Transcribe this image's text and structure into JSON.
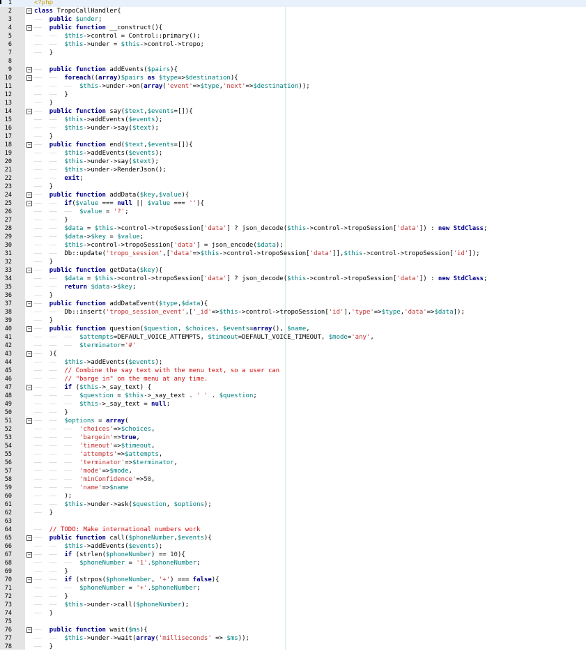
{
  "editor": {
    "lines": [
      {
        "n": "1",
        "fold": "",
        "code": "<?php"
      },
      {
        "n": "2",
        "fold": "−",
        "code": "class TropoCallHandler{"
      },
      {
        "n": "3",
        "fold": "",
        "code": "    public $under;"
      },
      {
        "n": "4",
        "fold": "−",
        "code": "    public function __construct(){"
      },
      {
        "n": "5",
        "fold": "",
        "code": "        $this->control = Control::primary();"
      },
      {
        "n": "6",
        "fold": "",
        "code": "        $this->under = $this->control->tropo;"
      },
      {
        "n": "7",
        "fold": "",
        "code": "    }"
      },
      {
        "n": "8",
        "fold": "",
        "code": ""
      },
      {
        "n": "9",
        "fold": "−",
        "code": "    public function addEvents($pairs){"
      },
      {
        "n": "10",
        "fold": "−",
        "code": "        foreach((array)$pairs as $type=>$destination){"
      },
      {
        "n": "11",
        "fold": "",
        "code": "            $this->under->on(array('event'=>$type,'next'=>$destination));"
      },
      {
        "n": "12",
        "fold": "",
        "code": "        }"
      },
      {
        "n": "13",
        "fold": "",
        "code": "    }"
      },
      {
        "n": "14",
        "fold": "−",
        "code": "    public function say($text,$events=[]){"
      },
      {
        "n": "15",
        "fold": "",
        "code": "        $this->addEvents($events);"
      },
      {
        "n": "16",
        "fold": "",
        "code": "        $this->under->say($text);"
      },
      {
        "n": "17",
        "fold": "",
        "code": "    }"
      },
      {
        "n": "18",
        "fold": "−",
        "code": "    public function end($text,$events=[]){"
      },
      {
        "n": "19",
        "fold": "",
        "code": "        $this->addEvents($events);"
      },
      {
        "n": "20",
        "fold": "",
        "code": "        $this->under->say($text);"
      },
      {
        "n": "21",
        "fold": "",
        "code": "        $this->under->RenderJson();"
      },
      {
        "n": "22",
        "fold": "",
        "code": "        exit;"
      },
      {
        "n": "23",
        "fold": "",
        "code": "    }"
      },
      {
        "n": "24",
        "fold": "−",
        "code": "    public function addData($key,$value){"
      },
      {
        "n": "25",
        "fold": "−",
        "code": "        if($value === null || $value === ''){"
      },
      {
        "n": "26",
        "fold": "",
        "code": "            $value = '?';"
      },
      {
        "n": "27",
        "fold": "",
        "code": "        }"
      },
      {
        "n": "28",
        "fold": "",
        "code": "        $data = $this->control->tropoSession['data'] ? json_decode($this->control->tropoSession['data']) : new StdClass;"
      },
      {
        "n": "29",
        "fold": "",
        "code": "        $data->$key = $value;"
      },
      {
        "n": "30",
        "fold": "",
        "code": "        $this->control->tropoSession['data'] = json_encode($data);"
      },
      {
        "n": "31",
        "fold": "",
        "code": "        Db::update('tropo_session',['data'=>$this->control->tropoSession['data']],$this->control->tropoSession['id']);"
      },
      {
        "n": "32",
        "fold": "",
        "code": "    }"
      },
      {
        "n": "33",
        "fold": "−",
        "code": "    public function getData($key){"
      },
      {
        "n": "34",
        "fold": "",
        "code": "        $data = $this->control->tropoSession['data'] ? json_decode($this->control->tropoSession['data']) : new StdClass;"
      },
      {
        "n": "35",
        "fold": "",
        "code": "        return $data->$key;"
      },
      {
        "n": "36",
        "fold": "",
        "code": "    }"
      },
      {
        "n": "37",
        "fold": "−",
        "code": "    public function addDataEvent($type,$data){"
      },
      {
        "n": "38",
        "fold": "",
        "code": "        Db::insert('tropo_session_event',['_id'=>$this->control->tropoSession['id'],'type'=>$type,'data'=>$data]);"
      },
      {
        "n": "39",
        "fold": "",
        "code": "    }"
      },
      {
        "n": "40",
        "fold": "−",
        "code": "    public function question($question, $choices, $events=array(), $name,"
      },
      {
        "n": "41",
        "fold": "",
        "code": "            $attempts=DEFAULT_VOICE_ATTEMPTS, $timeout=DEFAULT_VOICE_TIMEOUT, $mode='any',"
      },
      {
        "n": "42",
        "fold": "",
        "code": "            $terminator='#'"
      },
      {
        "n": "43",
        "fold": "−",
        "code": "    ){"
      },
      {
        "n": "44",
        "fold": "",
        "code": "        $this->addEvents($events);"
      },
      {
        "n": "45",
        "fold": "",
        "code": "        // Combine the say text with the menu text, so a user can"
      },
      {
        "n": "46",
        "fold": "",
        "code": "        // \"barge in\" on the menu at any time."
      },
      {
        "n": "47",
        "fold": "−",
        "code": "        if ($this->_say_text) {"
      },
      {
        "n": "48",
        "fold": "",
        "code": "            $question = $this->_say_text . ' ' . $question;"
      },
      {
        "n": "49",
        "fold": "",
        "code": "            $this->_say_text = null;"
      },
      {
        "n": "50",
        "fold": "",
        "code": "        }"
      },
      {
        "n": "51",
        "fold": "−",
        "code": "        $options = array("
      },
      {
        "n": "52",
        "fold": "",
        "code": "            'choices'=>$choices,"
      },
      {
        "n": "53",
        "fold": "",
        "code": "            'bargein'=>true,"
      },
      {
        "n": "54",
        "fold": "",
        "code": "            'timeout'=>$timeout,"
      },
      {
        "n": "55",
        "fold": "",
        "code": "            'attempts'=>$attempts,"
      },
      {
        "n": "56",
        "fold": "",
        "code": "            'terminator'=>$terminator,"
      },
      {
        "n": "57",
        "fold": "",
        "code": "            'mode'=>$mode,"
      },
      {
        "n": "58",
        "fold": "",
        "code": "            'minConfidence'=>50,"
      },
      {
        "n": "59",
        "fold": "",
        "code": "            'name'=>$name"
      },
      {
        "n": "60",
        "fold": "",
        "code": "        );"
      },
      {
        "n": "61",
        "fold": "",
        "code": "        $this->under->ask($question, $options);"
      },
      {
        "n": "62",
        "fold": "",
        "code": "    }"
      },
      {
        "n": "63",
        "fold": "",
        "code": ""
      },
      {
        "n": "64",
        "fold": "",
        "code": "    // TODO: Make international numbers work"
      },
      {
        "n": "65",
        "fold": "−",
        "code": "    public function call($phoneNumber,$events){"
      },
      {
        "n": "66",
        "fold": "",
        "code": "        $this->addEvents($events);"
      },
      {
        "n": "67",
        "fold": "−",
        "code": "        if (strlen($phoneNumber) == 10){"
      },
      {
        "n": "68",
        "fold": "",
        "code": "            $phoneNumber = '1'.$phoneNumber;"
      },
      {
        "n": "69",
        "fold": "",
        "code": "        }"
      },
      {
        "n": "70",
        "fold": "−",
        "code": "        if (strpos($phoneNumber, '+') === false){"
      },
      {
        "n": "71",
        "fold": "",
        "code": "            $phoneNumber = '+'.$phoneNumber;"
      },
      {
        "n": "72",
        "fold": "",
        "code": "        }"
      },
      {
        "n": "73",
        "fold": "",
        "code": "        $this->under->call($phoneNumber);"
      },
      {
        "n": "74",
        "fold": "",
        "code": "    }"
      },
      {
        "n": "75",
        "fold": "",
        "code": ""
      },
      {
        "n": "76",
        "fold": "−",
        "code": "    public function wait($ms){"
      },
      {
        "n": "77",
        "fold": "",
        "code": "        $this->under->wait(array('milliseconds' => $ms));"
      },
      {
        "n": "78",
        "fold": "",
        "code": "    }"
      }
    ],
    "colors": {
      "keyword": "#00008b",
      "variable": "#008080",
      "string": "#c03030",
      "comment": "#d01010",
      "php_tag": "#c8a000",
      "gutter": "#e4e4e4",
      "current_line": "#e8f0fb"
    },
    "icons": {
      "fold_marker": "minus-box-icon"
    }
  }
}
